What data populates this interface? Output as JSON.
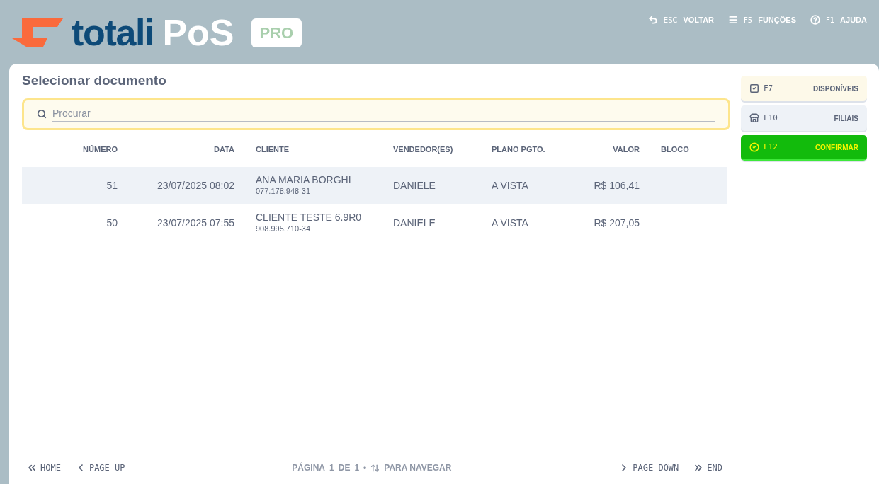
{
  "logo": {
    "word": "totali",
    "product": "PoS",
    "edition": "PRO"
  },
  "header_actions": [
    {
      "kind": "back",
      "key": "ESC",
      "label": "VOLTAR"
    },
    {
      "kind": "menu",
      "key": "F5",
      "label": "FUNÇÕES"
    },
    {
      "kind": "help",
      "key": "F1",
      "label": "AJUDA"
    }
  ],
  "title": "Selecionar documento",
  "search": {
    "placeholder": "Procurar"
  },
  "table": {
    "columns": [
      "NÚMERO",
      "DATA",
      "CLIENTE",
      "VENDEDOR(ES)",
      "PLANO PGTO.",
      "VALOR",
      "BLOCO"
    ],
    "rows": [
      {
        "selected": true,
        "numero": "51",
        "data": "23/07/2025 08:02",
        "cliente": "ANA MARIA BORGHI",
        "documento": "077.178.948-31",
        "vendedor": "DANIELE",
        "plano": "A VISTA",
        "valor": "R$ 106,41"
      },
      {
        "selected": false,
        "numero": "50",
        "data": "23/07/2025 07:55",
        "cliente": "CLIENTE TESTE 6.9R0",
        "documento": "908.995.710-34",
        "vendedor": "DANIELE",
        "plano": "A VISTA",
        "valor": "R$ 207,05"
      }
    ]
  },
  "footer": {
    "left": [
      {
        "kind": "first",
        "key": "HOME"
      },
      {
        "kind": "prev",
        "key": "PAGE UP"
      }
    ],
    "status": {
      "page_label": "PÁGINA",
      "current": "1",
      "of": "DE",
      "total": "1",
      "separator": "•",
      "hint": "PARA NAVEGAR"
    },
    "right": [
      {
        "kind": "next",
        "key": "PAGE DOWN"
      },
      {
        "kind": "last",
        "key": "END"
      }
    ]
  },
  "side_actions": [
    {
      "kind": "available",
      "key": "F7",
      "label": "DISPONÍVEIS"
    },
    {
      "kind": "branches",
      "key": "F10",
      "label": "FILIAIS"
    },
    {
      "kind": "confirm",
      "key": "F12",
      "label": "CONFIRMAR"
    }
  ]
}
